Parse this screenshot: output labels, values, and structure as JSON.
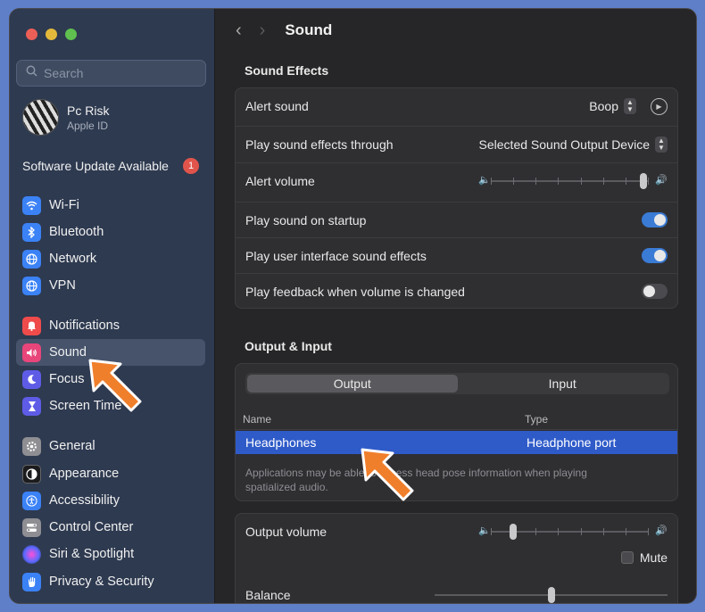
{
  "window": {
    "title": "Sound"
  },
  "search": {
    "placeholder": "Search"
  },
  "profile": {
    "name": "Pc Risk",
    "sub": "Apple ID"
  },
  "update": {
    "label": "Software Update Available",
    "badge": "1"
  },
  "sidebar": {
    "items": [
      {
        "label": "Wi-Fi",
        "icon": "wifi-icon",
        "color": "#3b82f6"
      },
      {
        "label": "Bluetooth",
        "icon": "bluetooth-icon",
        "color": "#3b82f6"
      },
      {
        "label": "Network",
        "icon": "globe-icon",
        "color": "#3b82f6"
      },
      {
        "label": "VPN",
        "icon": "vpn-globe-icon",
        "color": "#3b82f6"
      },
      {
        "label": "Notifications",
        "icon": "bell-icon",
        "color": "#ef4b4b"
      },
      {
        "label": "Sound",
        "icon": "speaker-icon",
        "color": "#e8457a",
        "selected": true
      },
      {
        "label": "Focus",
        "icon": "moon-icon",
        "color": "#5e5ce6"
      },
      {
        "label": "Screen Time",
        "icon": "hourglass-icon",
        "color": "#5e5ce6"
      },
      {
        "label": "General",
        "icon": "gear-icon",
        "color": "#8e8e93"
      },
      {
        "label": "Appearance",
        "icon": "appearance-icon",
        "color": "#1c1c1e"
      },
      {
        "label": "Accessibility",
        "icon": "accessibility-icon",
        "color": "#3b82f6"
      },
      {
        "label": "Control Center",
        "icon": "control-center-icon",
        "color": "#8e8e93"
      },
      {
        "label": "Siri & Spotlight",
        "icon": "siri-icon",
        "color": "#5b6bff"
      },
      {
        "label": "Privacy & Security",
        "icon": "hand-icon",
        "color": "#3b82f6"
      }
    ]
  },
  "sound_effects": {
    "title": "Sound Effects",
    "alert_sound": {
      "label": "Alert sound",
      "value": "Boop"
    },
    "output_device": {
      "label": "Play sound effects through",
      "value": "Selected Sound Output Device"
    },
    "alert_volume": {
      "label": "Alert volume",
      "level": 0.97
    },
    "startup": {
      "label": "Play sound on startup",
      "on": true
    },
    "ui_effects": {
      "label": "Play user interface sound effects",
      "on": true
    },
    "feedback": {
      "label": "Play feedback when volume is changed",
      "on": false
    }
  },
  "output_input": {
    "title": "Output & Input",
    "tabs": [
      "Output",
      "Input"
    ],
    "selected_tab": "Output",
    "columns": [
      "Name",
      "Type"
    ],
    "devices": [
      {
        "name": "Headphones",
        "type": "Headphone port",
        "selected": true
      }
    ],
    "note": "Applications may be able to access head pose information when playing spatialized audio."
  },
  "output_volume": {
    "label": "Output volume",
    "level": 0.14,
    "mute_label": "Mute",
    "muted": false
  },
  "balance": {
    "label": "Balance",
    "level": 0.5
  },
  "colors": {
    "accent": "#3a7bd5",
    "selection": "#2f5bc9",
    "annotation": "#f07f2c"
  }
}
